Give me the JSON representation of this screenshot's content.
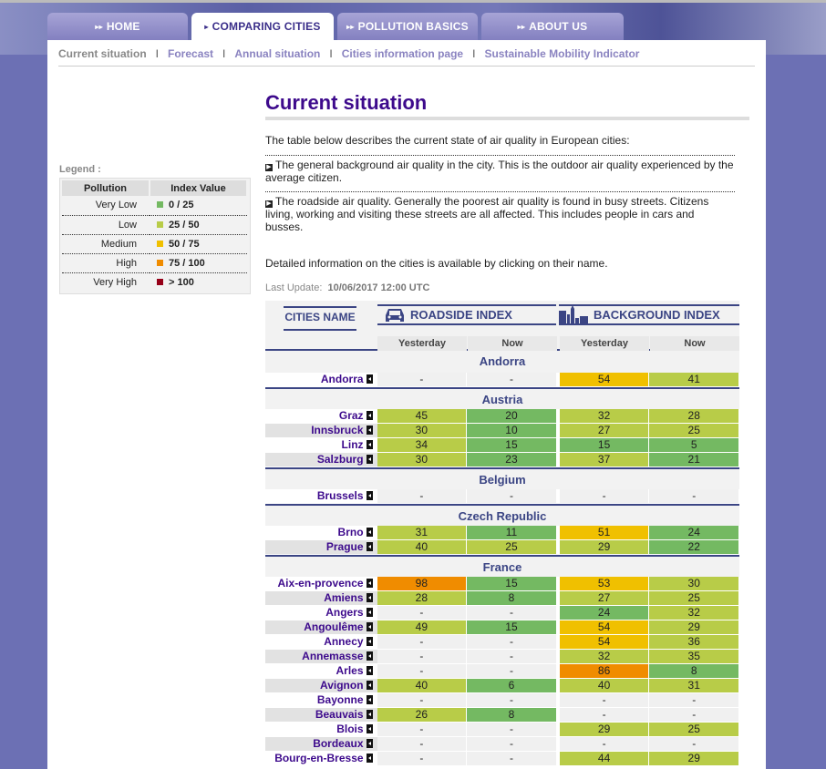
{
  "nav": {
    "tabs": [
      {
        "label": "HOME",
        "active": false
      },
      {
        "label": "COMPARING CITIES",
        "active": true
      },
      {
        "label": "POLLUTION BASICS",
        "active": false
      },
      {
        "label": "ABOUT US",
        "active": false
      }
    ]
  },
  "subnav": {
    "items": [
      "Current situation",
      "Forecast",
      "Annual situation",
      "Cities information page",
      "Sustainable Mobility Indicator"
    ],
    "current": 0
  },
  "legend": {
    "title": "Legend :",
    "col_pollution": "Pollution",
    "col_index": "Index Value",
    "rows": [
      {
        "level": "Very Low",
        "range": "0 / 25",
        "color": "#74b962"
      },
      {
        "level": "Low",
        "range": "25 / 50",
        "color": "#b8cc48"
      },
      {
        "level": "Medium",
        "range": "50 / 75",
        "color": "#f0c000"
      },
      {
        "level": "High",
        "range": "75 / 100",
        "color": "#f08c00"
      },
      {
        "level": "Very High",
        "range": "> 100",
        "color": "#960018"
      }
    ]
  },
  "main": {
    "title": "Current situation",
    "intro": "The table below describes the current state of air quality in European cities:",
    "bullet1": "The general background air quality in the city. This is the outdoor air quality experienced by the average citizen.",
    "bullet2": "The roadside air quality. Generally the poorest air quality is found in busy streets. Citizens living, working and visiting these streets are all affected. This includes people in cars and busses.",
    "detail": "Detailed information on the cities is available by clicking on their name.",
    "last_update_label": "Last Update:",
    "last_update": "10/06/2017 12:00 UTC"
  },
  "table": {
    "cities_header": "CITIES NAME",
    "roadside_header": "ROADSIDE INDEX",
    "background_header": "BACKGROUND INDEX",
    "yesterday": "Yesterday",
    "now": "Now",
    "groups": [
      {
        "country": "Andorra",
        "cities": [
          [
            "Andorra",
            "-",
            "-",
            "54",
            "41"
          ]
        ]
      },
      {
        "country": "Austria",
        "cities": [
          [
            "Graz",
            "45",
            "20",
            "32",
            "28"
          ],
          [
            "Innsbruck",
            "30",
            "10",
            "27",
            "25"
          ],
          [
            "Linz",
            "34",
            "15",
            "15",
            "5"
          ],
          [
            "Salzburg",
            "30",
            "23",
            "37",
            "21"
          ]
        ]
      },
      {
        "country": "Belgium",
        "cities": [
          [
            "Brussels",
            "-",
            "-",
            "-",
            "-"
          ]
        ]
      },
      {
        "country": "Czech Republic",
        "cities": [
          [
            "Brno",
            "31",
            "11",
            "51",
            "24"
          ],
          [
            "Prague",
            "40",
            "25",
            "29",
            "22"
          ]
        ]
      },
      {
        "country": "France",
        "cities": [
          [
            "Aix-en-provence",
            "98",
            "15",
            "53",
            "30"
          ],
          [
            "Amiens",
            "28",
            "8",
            "27",
            "25"
          ],
          [
            "Angers",
            "-",
            "-",
            "24",
            "32"
          ],
          [
            "Angoulême",
            "49",
            "15",
            "54",
            "29"
          ],
          [
            "Annecy",
            "-",
            "-",
            "54",
            "36"
          ],
          [
            "Annemasse",
            "-",
            "-",
            "32",
            "35"
          ],
          [
            "Arles",
            "-",
            "-",
            "86",
            "8"
          ],
          [
            "Avignon",
            "40",
            "6",
            "40",
            "31"
          ],
          [
            "Bayonne",
            "-",
            "-",
            "-",
            "-"
          ],
          [
            "Beauvais",
            "26",
            "8",
            "-",
            "-"
          ],
          [
            "Blois",
            "-",
            "-",
            "29",
            "25"
          ],
          [
            "Bordeaux",
            "-",
            "-",
            "-",
            "-"
          ],
          [
            "Bourg-en-Bresse",
            "-",
            "-",
            "44",
            "29"
          ]
        ]
      }
    ]
  }
}
